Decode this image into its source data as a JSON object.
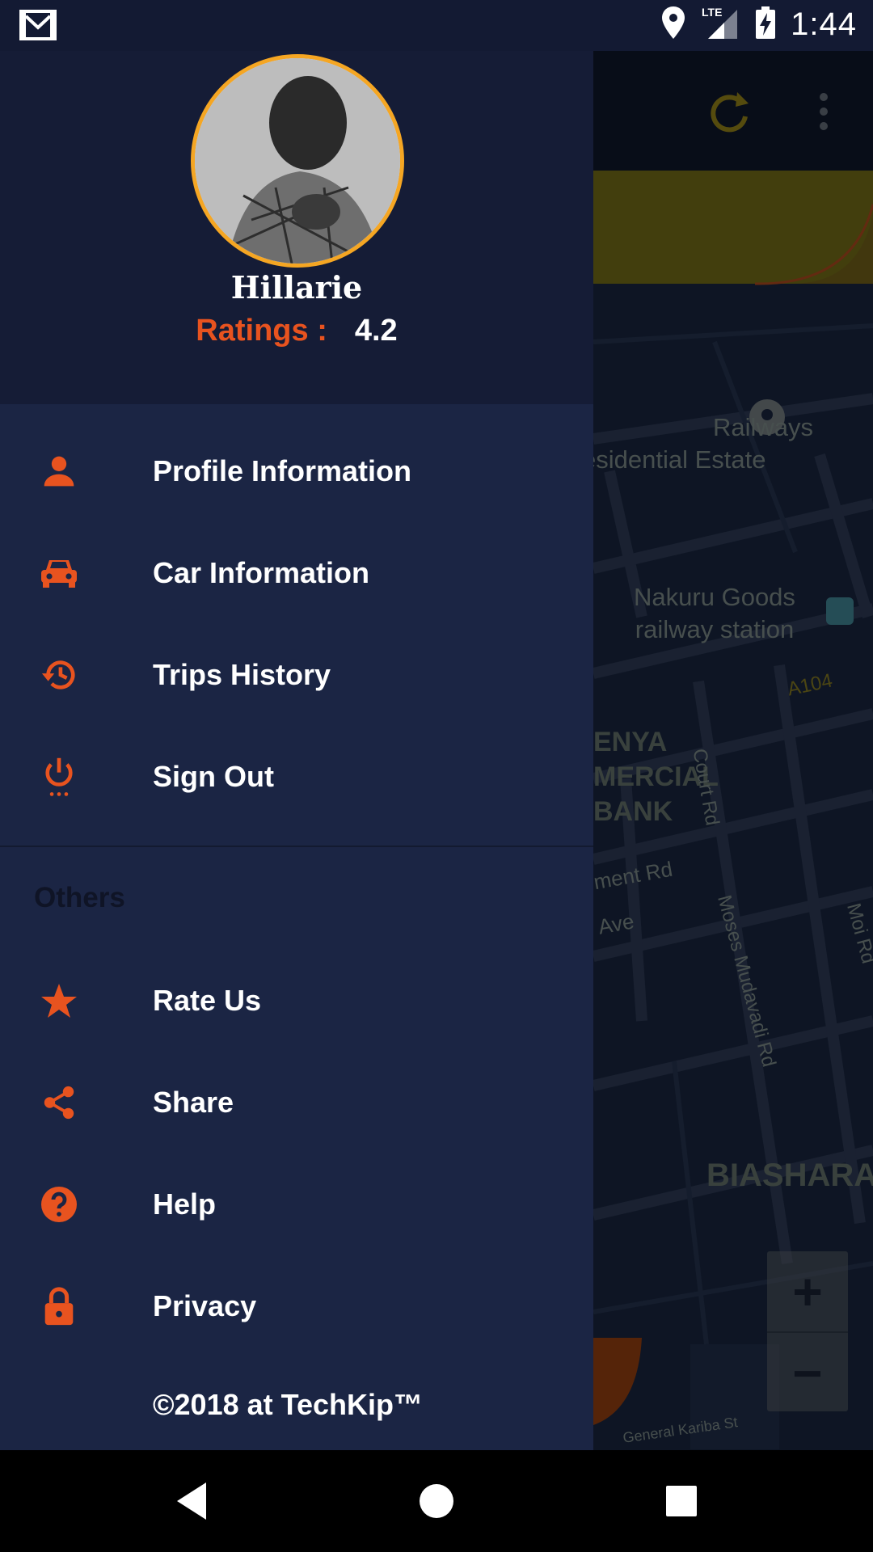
{
  "status": {
    "time": "1:44",
    "network": "LTE"
  },
  "profile": {
    "name": "Hillarie",
    "ratings_label": "Ratings :",
    "ratings_value": "4.2"
  },
  "menu": [
    {
      "label": "Profile Information",
      "icon": "person-icon"
    },
    {
      "label": "Car Information",
      "icon": "car-icon"
    },
    {
      "label": "Trips History",
      "icon": "history-icon"
    },
    {
      "label": "Sign Out",
      "icon": "power-icon"
    }
  ],
  "others_title": "Others",
  "others": [
    {
      "label": "Rate Us",
      "icon": "star-icon"
    },
    {
      "label": "Share",
      "icon": "share-icon"
    },
    {
      "label": "Help",
      "icon": "help-icon"
    },
    {
      "label": "Privacy",
      "icon": "lock-icon"
    }
  ],
  "footer": "©2018 at TechKip™",
  "map": {
    "labels": [
      "Railways",
      "esidential Estate",
      "Nakuru Goods",
      "railway station",
      "A104",
      "ENYA",
      "MERCIAL",
      "BANK",
      "Court Rd",
      "ment Rd",
      "Ave",
      "Moses Mudavadi Rd",
      "Moi Rd",
      "BIASHARA",
      "General Kariba St"
    ],
    "zoom_in": "+",
    "zoom_out": "−"
  },
  "colors": {
    "accent": "#e8531f",
    "drawer_bg": "#1b2544",
    "header_bg": "#151c36",
    "avatar_ring": "#f5a623"
  }
}
